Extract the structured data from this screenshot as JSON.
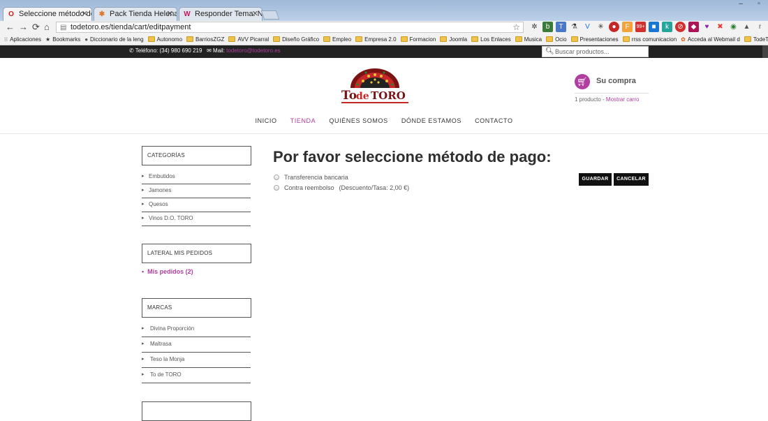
{
  "browser": {
    "tabs": [
      {
        "title": "Seleccione método de pa",
        "favicon": "opera-icon"
      },
      {
        "title": "Pack Tienda Helena - Adr",
        "favicon": "joomla-icon"
      },
      {
        "title": "Responder Tema: No se a",
        "favicon": "w-icon"
      }
    ],
    "url": "todetoro.es/tienda/cart/editpayment",
    "bookmarks": [
      {
        "label": "Aplicaciones",
        "icon": "apps-icon"
      },
      {
        "label": "Bookmarks",
        "icon": "star-icon"
      },
      {
        "label": "Diccionario de la leng",
        "icon": "dictionary-icon"
      },
      {
        "label": "Autonomo",
        "icon": "folder-icon"
      },
      {
        "label": "BarriosZGZ",
        "icon": "folder-icon"
      },
      {
        "label": "AVV Picarral",
        "icon": "folder-icon"
      },
      {
        "label": "Diseño Gráfico",
        "icon": "folder-icon"
      },
      {
        "label": "Empleo",
        "icon": "folder-icon"
      },
      {
        "label": "Empresa 2.0",
        "icon": "folder-icon"
      },
      {
        "label": "Formacion",
        "icon": "folder-icon"
      },
      {
        "label": "Joomla",
        "icon": "folder-icon"
      },
      {
        "label": "Los Enlaces",
        "icon": "folder-icon"
      },
      {
        "label": "Musica",
        "icon": "folder-icon"
      },
      {
        "label": "Ocio",
        "icon": "folder-icon"
      },
      {
        "label": "Presentaciones",
        "icon": "folder-icon"
      },
      {
        "label": "rrss comunicacion",
        "icon": "folder-icon"
      },
      {
        "label": "Acceda al Webmail d",
        "icon": "webmail-icon"
      },
      {
        "label": "TodeT",
        "icon": "folder-icon"
      }
    ],
    "extension_badge": "99+"
  },
  "site": {
    "phone": "Teléfono: (34) 980 690 219",
    "mail_label": "Mail:",
    "mail": "todetoro@todetoro.es",
    "search_placeholder": "Buscar productos...",
    "logo_text_to": "To",
    "logo_text_de": "de",
    "logo_text_toro": "TORO",
    "cart": {
      "title": "Su compra",
      "count": "1 producto",
      "separator": " - ",
      "show": "Mostrar carro"
    },
    "nav": [
      "INICIO",
      "TIENDA",
      "QUIÉNES SOMOS",
      "DÓNDE ESTAMOS",
      "CONTACTO"
    ],
    "active_nav": "TIENDA",
    "accent_color": "#b03fa0"
  },
  "sidebar": {
    "categories_title": "CATEGORÍAS",
    "categories": [
      "Embutidos",
      "Jamones",
      "Quesos",
      "Vinos D.O. TORO"
    ],
    "orders_title": "LATERAL MIS PEDIDOS",
    "orders_link": "Mis pedidos (2)",
    "brands_title": "MARCAS",
    "brands": [
      "Divina Proporción",
      "Maltrasa",
      "Teso la Monja",
      "To de TORO"
    ]
  },
  "main": {
    "heading": "Por favor seleccione método de pago:",
    "payment_methods": [
      {
        "label": "Transferencia bancaria",
        "note": ""
      },
      {
        "label": "Contra reembolso",
        "note": "(Descuento/Tasa: 2,00 €)"
      }
    ],
    "save_label": "GUARDAR",
    "cancel_label": "CANCELAR"
  }
}
